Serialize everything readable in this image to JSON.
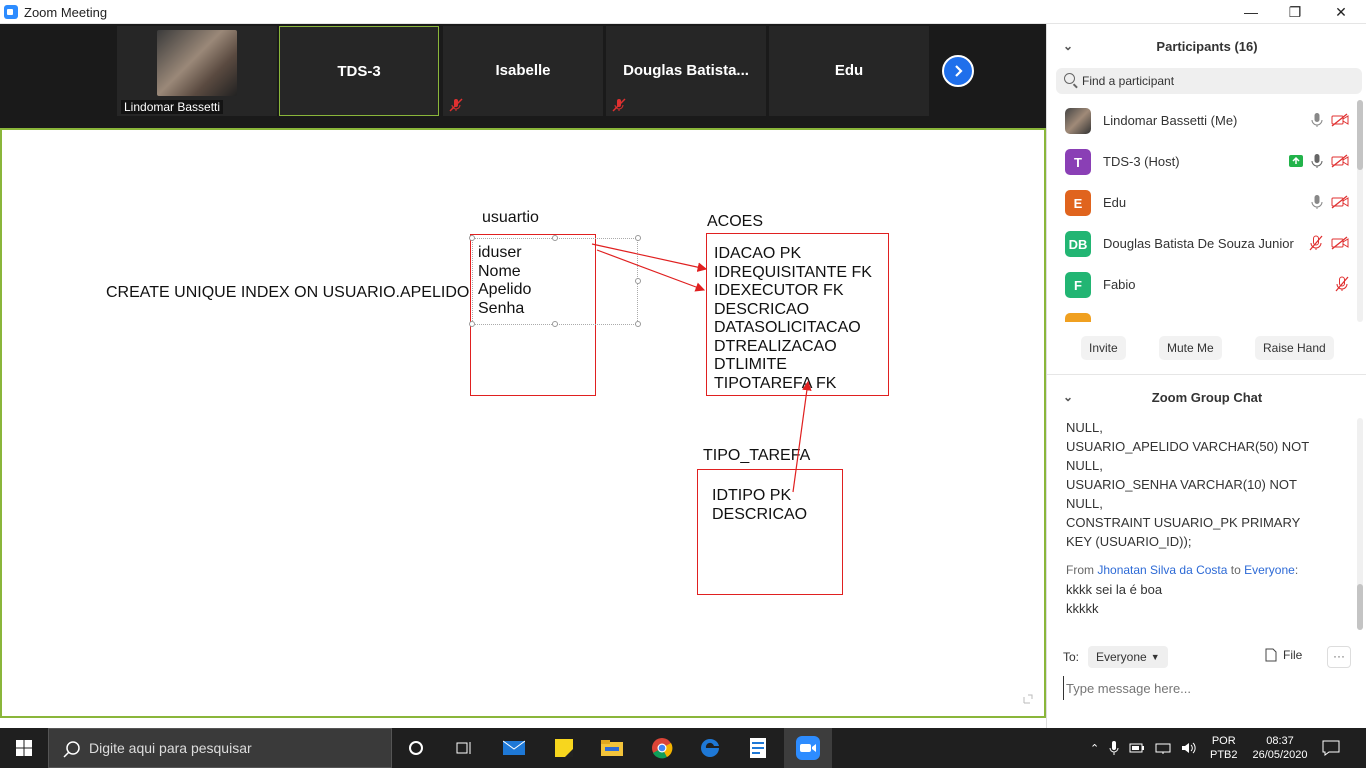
{
  "window": {
    "title": "Zoom Meeting",
    "minimize": "—",
    "maximize": "❐",
    "close": "✕"
  },
  "video_strip": {
    "tiles": [
      {
        "name": "Lindomar Bassetti",
        "has_video": true
      },
      {
        "name": "TDS-3",
        "active": true
      },
      {
        "name": "Isabelle",
        "muted": true
      },
      {
        "name": "Douglas  Batista...",
        "muted": true
      },
      {
        "name": "Edu"
      }
    ]
  },
  "whiteboard": {
    "create_index_text": "CREATE UNIQUE INDEX ON USUARIO.APELIDO",
    "usuario": {
      "label": "usuartio",
      "fields": [
        "iduser",
        "Nome",
        "Apelido",
        "Senha"
      ]
    },
    "acoes": {
      "label": "ACOES",
      "fields": [
        "IDACAO PK",
        "IDREQUISITANTE FK",
        "IDEXECUTOR FK",
        "DESCRICAO",
        "DATASOLICITACAO",
        "DTREALIZACAO",
        "DTLIMITE",
        "TIPOTAREFA FK"
      ]
    },
    "tipo_tarefa": {
      "label": "TIPO_TAREFA",
      "fields": [
        "IDTIPO  PK",
        "DESCRICAO"
      ]
    },
    "arrow_color": "#e02020"
  },
  "participants": {
    "header": "Participants (16)",
    "search_placeholder": "Find a participant",
    "list": [
      {
        "initials": "",
        "name": "Lindomar Bassetti (Me)",
        "avatar_color": "#6b5a50",
        "photo": true,
        "mic": "on",
        "video": "off"
      },
      {
        "initials": "T",
        "name": "TDS-3 (Host)",
        "avatar_color": "#8a3fb5",
        "share": true,
        "mic": "on",
        "video": "off"
      },
      {
        "initials": "E",
        "name": "Edu",
        "avatar_color": "#e0641e",
        "mic": "on",
        "video": "off"
      },
      {
        "initials": "DB",
        "name": "Douglas Batista De Souza Junior",
        "avatar_color": "#22b573",
        "mic": "off",
        "video": "off"
      },
      {
        "initials": "F",
        "name": "Fabio",
        "avatar_color": "#22b573",
        "mic": "off"
      },
      {
        "initials": "",
        "name": "",
        "avatar_color": "#f0a020",
        "mic": "off"
      }
    ],
    "actions": [
      "Invite",
      "Mute Me",
      "Raise Hand"
    ]
  },
  "chat": {
    "header": "Zoom Group Chat",
    "lines": [
      "NULL,",
      "USUARIO_APELIDO VARCHAR(50) NOT",
      "NULL,",
      "USUARIO_SENHA VARCHAR(10) NOT",
      "NULL,",
      "CONSTRAINT USUARIO_PK PRIMARY",
      "KEY (USUARIO_ID));"
    ],
    "from_prefix": "From ",
    "from_name": "Jhonatan Silva da Costa",
    "to_word": " to ",
    "to_target": "Everyone",
    "from_suffix": ":",
    "messages": [
      "kkkk sei la é boa",
      "kkkkk"
    ],
    "to_label": "To:",
    "to_value": "Everyone",
    "file_label": "File",
    "more_label": "···",
    "input_placeholder": "Type message here..."
  },
  "taskbar": {
    "search_placeholder": "Digite aqui para pesquisar",
    "lang_top": "POR",
    "lang_bottom": "PTB2",
    "time": "08:37",
    "date": "26/05/2020"
  }
}
